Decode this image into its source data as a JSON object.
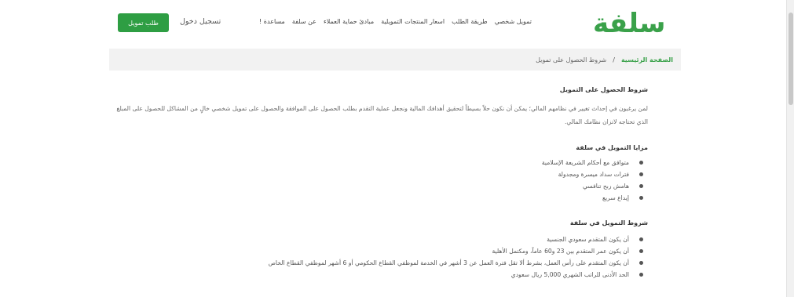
{
  "header": {
    "logo": "سلفة",
    "nav": [
      "تمويل شخصي",
      "طريقة الطلب",
      "اسعار المنتجات التمويلية",
      "مبادئ حماية العملاء",
      "عن سلفة",
      "مساعدة !"
    ],
    "login": "تسجيل دخول",
    "apply_button": "طلب تمويل"
  },
  "breadcrumb": {
    "home": "الصفحة الرئيسية",
    "separator": "/",
    "current": "شروط الحصول على تمويل"
  },
  "content": {
    "section1_title": "شروط  الحصول على التمويل",
    "section1_paragraph": "لمن يرغبون في إحداث تغيير في نظامهم المالي؛ يمكن أن نكون حلاً بسيطاً لتحقيق أهدافك المالية ونجعل عملية التقدم بطلب الحصول على الموافقة والحصول على تمويل شخصي خالٍ من المشاكل للحصول على المبلغ الذي تحتاجه لاتزان نظامك المالي.",
    "section2_title": "مزايا التمويل في سلفة",
    "section2_items": [
      "متوافق مع أحكام الشريعة الإسلامية",
      "فترات سداد ميسرة ومجدولة",
      "هامش ربح تنافسي",
      "إيداع سريع"
    ],
    "section3_title": "شروط التمويل في سلفة",
    "section3_items": [
      "أن يكون المتقدم سعودي الجنسية",
      "أن يكون عمر المتقدم بين 23 و60 عاماً، ومكتمل الأهلية",
      "أن يكون المتقدم على رأس العمل، بشرط ألا تقل فترة العمل عن 3 أشهر في الخدمة لموظفي القطاع الحكومي أو 6 أشهر لموظفي القطاع الخاص",
      "الحد الأدنى للراتب الشهري 5,000 ريال سعودي"
    ]
  },
  "colors": {
    "brand_green": "#3aa14a",
    "button_green": "#2e9e43",
    "breadcrumb_bg": "#f2f2f2"
  }
}
